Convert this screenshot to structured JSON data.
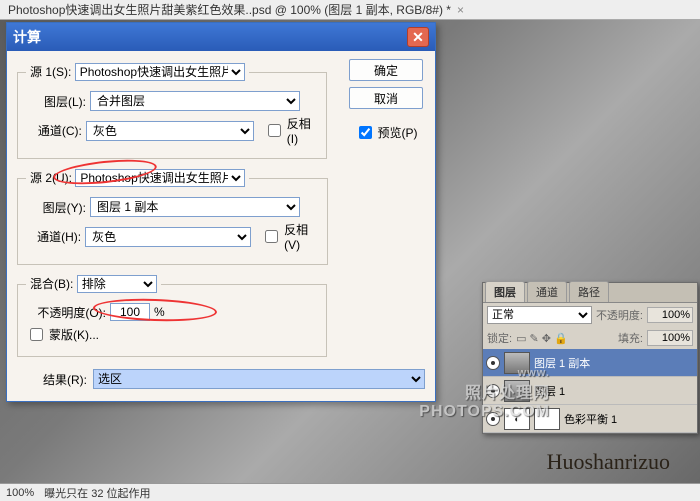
{
  "document": {
    "tab_title": "Photoshop快速调出女生照片甜美紫红色效果..psd @ 100% (图层 1 副本, RGB/8#) *"
  },
  "dialog": {
    "title": "计算",
    "source1": {
      "legend_prefix": "源 1(S):",
      "file": "Photoshop快速调出女生照片...",
      "layer_label": "图层(L):",
      "layer_value": "合并图层",
      "channel_label": "通道(C):",
      "channel_value": "灰色",
      "invert_label": "反相(I)"
    },
    "source2": {
      "legend_prefix": "源 2(U):",
      "file": "Photoshop快速调出女生照片...",
      "layer_label": "图层(Y):",
      "layer_value": "图层 1 副本",
      "channel_label": "通道(H):",
      "channel_value": "灰色",
      "invert_label": "反相(V)"
    },
    "blend": {
      "label": "混合(B):",
      "value": "排除",
      "opacity_label": "不透明度(O):",
      "opacity_value": "100",
      "opacity_unit": "%",
      "mask_label": "蒙版(K)..."
    },
    "result": {
      "label": "结果(R):",
      "value": "选区"
    },
    "buttons": {
      "ok": "确定",
      "cancel": "取消",
      "preview": "预览(P)"
    }
  },
  "layers_panel": {
    "tabs": {
      "layers": "图层",
      "channels": "通道",
      "paths": "路径"
    },
    "mode": {
      "value": "正常",
      "opacity_label": "不透明度:",
      "opacity_value": "100%"
    },
    "lock": {
      "lock_label": "锁定:",
      "fill_label": "填充:",
      "fill_value": "100%"
    },
    "items": [
      {
        "name": "图层 1 副本",
        "selected": true
      },
      {
        "name": "图层 1",
        "selected": false
      },
      {
        "name": "色彩平衡 1",
        "selected": false
      }
    ]
  },
  "status": {
    "zoom": "100%",
    "hint": "曝光只在 32 位起作用"
  },
  "watermark": {
    "site": "照片处理网",
    "url": "PHOTOPS.COM",
    "www": "www."
  },
  "signature": "Huoshanrizuo"
}
